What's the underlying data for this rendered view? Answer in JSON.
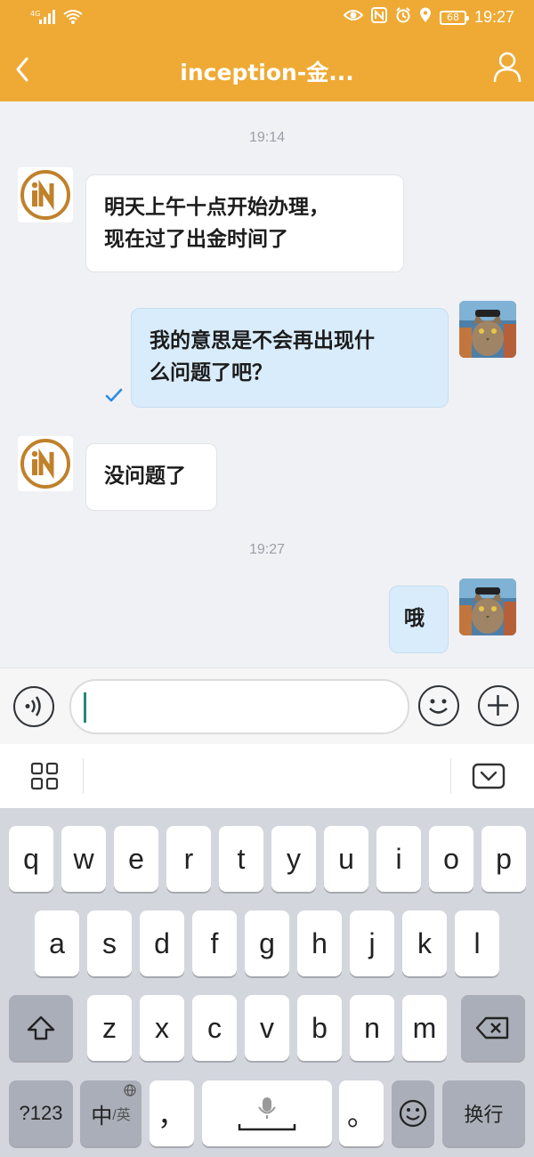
{
  "status_bar": {
    "signal_label": "4G",
    "battery": "68",
    "time": "19:27"
  },
  "header": {
    "title": "inception-金..."
  },
  "messages": [
    {
      "type": "timestamp",
      "text": "19:14"
    },
    {
      "type": "incoming",
      "text_lines": [
        "明天上午十点开始办理，",
        "现在过了出金时间了"
      ]
    },
    {
      "type": "outgoing",
      "text_lines": [
        "我的意思是不会再出现什",
        "么问题了吧？"
      ],
      "read": true
    },
    {
      "type": "incoming",
      "text_lines": [
        "没问题了"
      ]
    },
    {
      "type": "timestamp",
      "text": "19:27"
    },
    {
      "type": "outgoing",
      "text_lines": [
        "哦"
      ]
    }
  ],
  "input": {
    "value": ""
  },
  "keyboard": {
    "row1": [
      "q",
      "w",
      "e",
      "r",
      "t",
      "y",
      "u",
      "i",
      "o",
      "p"
    ],
    "row2": [
      "a",
      "s",
      "d",
      "f",
      "g",
      "h",
      "j",
      "k",
      "l"
    ],
    "row3": [
      "z",
      "x",
      "c",
      "v",
      "b",
      "n",
      "m"
    ],
    "bottom": {
      "numbers": "?123",
      "lang_main": "中",
      "lang_sub": "/英",
      "comma": "，",
      "period": "。",
      "enter": "换行"
    }
  },
  "colors": {
    "header": "#eeaa35",
    "outgoing_bubble": "#d9ecfb",
    "accent_check": "#2b8ce6"
  }
}
